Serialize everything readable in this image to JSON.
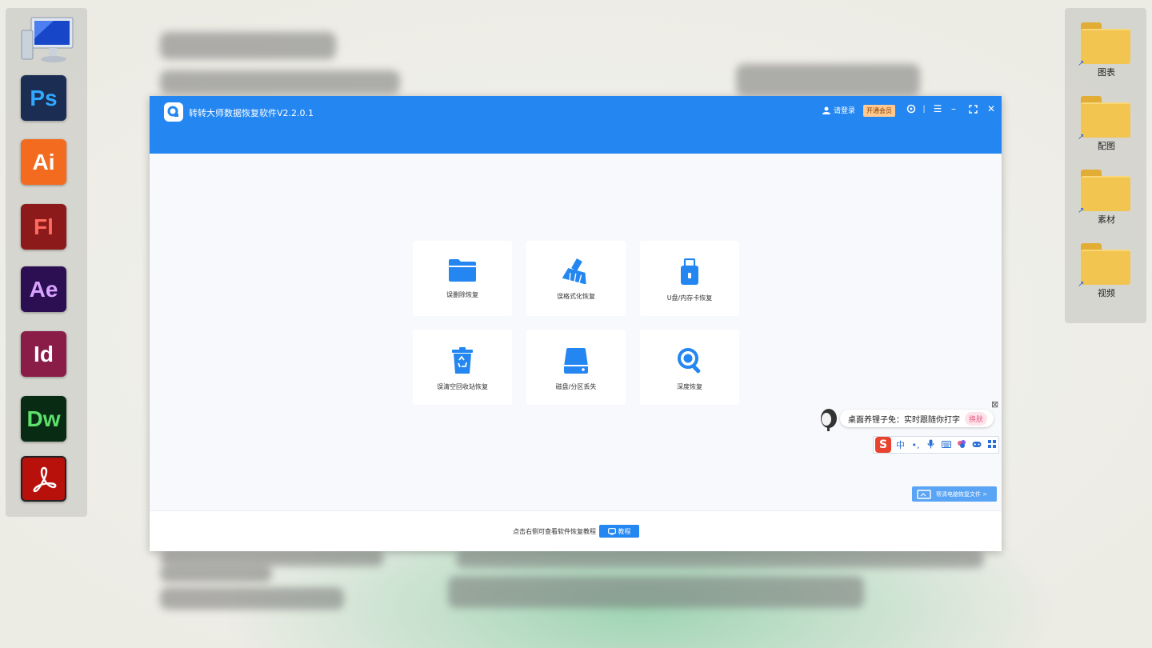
{
  "desktop": {
    "left_dock": [
      {
        "id": "my-computer",
        "icon": "computer-icon"
      },
      {
        "id": "ps",
        "text": "Ps",
        "bg": "#1b2d52",
        "fg": "#31a8ff"
      },
      {
        "id": "ai",
        "text": "Ai",
        "bg": "#f36b1f",
        "fg": "#ffffff"
      },
      {
        "id": "fl",
        "text": "Fl",
        "bg": "#8c1a1a",
        "fg": "#ff6b5f"
      },
      {
        "id": "ae",
        "text": "Ae",
        "bg": "#2b0f52",
        "fg": "#d9a3ff"
      },
      {
        "id": "id",
        "text": "Id",
        "bg": "#8a1d48",
        "fg": "#ffffff"
      },
      {
        "id": "dw",
        "text": "Dw",
        "bg": "#082b14",
        "fg": "#5de06c"
      },
      {
        "id": "acrobat",
        "icon": "acrobat-icon",
        "bg": "#b8110c"
      }
    ],
    "right_dock": [
      {
        "label": "图表"
      },
      {
        "label": "配图"
      },
      {
        "label": "素材"
      },
      {
        "label": "视频"
      }
    ]
  },
  "app": {
    "title": "转转大师数据恢复软件V2.2.0.1",
    "user_label": "请登录",
    "vip_label": "开通会员",
    "accent": "#2486f0",
    "cards": [
      {
        "label": "误删除恢复",
        "icon": "folder-icon"
      },
      {
        "label": "误格式化恢复",
        "icon": "broom-icon"
      },
      {
        "label": "U盘/内存卡恢复",
        "icon": "usb-drive-icon"
      },
      {
        "label": "误清空回收站恢复",
        "icon": "recycle-bin-icon"
      },
      {
        "label": "磁盘/分区丢失",
        "icon": "hard-disk-icon"
      },
      {
        "label": "深度恢复",
        "icon": "magnifier-icon"
      }
    ],
    "footer_text": "点击右侧可查看软件恢复教程",
    "tutorial_label": "教程",
    "side_button_label": "帮清电脑恢复文件 >"
  },
  "ime": {
    "tip_text": "桌面养锂子免：实时跟随你打字",
    "skin_label": "换肤",
    "bar_logo": "S",
    "bar_lang": "中",
    "bar_punct": "•,"
  }
}
